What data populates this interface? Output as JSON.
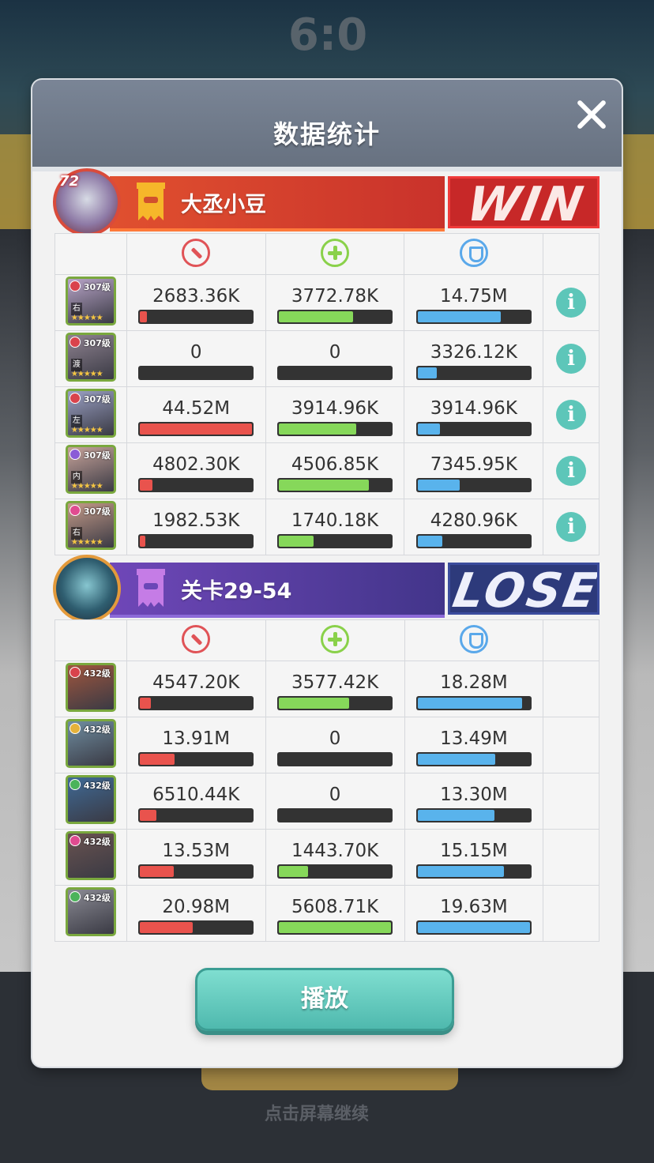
{
  "background": {
    "score": "6:0",
    "bottom_hint": "点击屏幕继续"
  },
  "panel": {
    "title": "数据统计",
    "close_icon": "close-icon"
  },
  "colors": {
    "damage": "#e9534d",
    "heal": "#86d85a",
    "defense": "#59b3ec",
    "info": "#5dc6b9",
    "play_button": "#5dc6b9"
  },
  "teams": [
    {
      "name": "大丞小豆",
      "level": "72",
      "result": "WIN",
      "has_info": true,
      "heroes": [
        {
          "level": "307级",
          "position": "右",
          "damage": "2683.36K",
          "damage_pct": 0.06,
          "heal": "3772.78K",
          "heal_pct": 0.66,
          "defense": "14.75M",
          "defense_pct": 0.74
        },
        {
          "level": "307级",
          "position": "渡",
          "damage": "0",
          "damage_pct": 0,
          "heal": "0",
          "heal_pct": 0,
          "defense": "3326.12K",
          "defense_pct": 0.17
        },
        {
          "level": "307级",
          "position": "左",
          "damage": "44.52M",
          "damage_pct": 1.0,
          "heal": "3914.96K",
          "heal_pct": 0.69,
          "defense": "3914.96K",
          "defense_pct": 0.2
        },
        {
          "level": "307级",
          "position": "内",
          "damage": "4802.30K",
          "damage_pct": 0.11,
          "heal": "4506.85K",
          "heal_pct": 0.8,
          "defense": "7345.95K",
          "defense_pct": 0.37
        },
        {
          "level": "307级",
          "position": "右",
          "damage": "1982.53K",
          "damage_pct": 0.05,
          "heal": "1740.18K",
          "heal_pct": 0.31,
          "defense": "4280.96K",
          "defense_pct": 0.22
        }
      ]
    },
    {
      "name": "关卡29-54",
      "result": "LOSE",
      "has_info": false,
      "heroes": [
        {
          "level": "432级",
          "damage": "4547.20K",
          "damage_pct": 0.1,
          "heal": "3577.42K",
          "heal_pct": 0.63,
          "defense": "18.28M",
          "defense_pct": 0.93
        },
        {
          "level": "432级",
          "damage": "13.91M",
          "damage_pct": 0.31,
          "heal": "0",
          "heal_pct": 0,
          "defense": "13.49M",
          "defense_pct": 0.69
        },
        {
          "level": "432级",
          "damage": "6510.44K",
          "damage_pct": 0.15,
          "heal": "0",
          "heal_pct": 0,
          "defense": "13.30M",
          "defense_pct": 0.68
        },
        {
          "level": "432级",
          "damage": "13.53M",
          "damage_pct": 0.3,
          "heal": "1443.70K",
          "heal_pct": 0.26,
          "defense": "15.15M",
          "defense_pct": 0.77
        },
        {
          "level": "432级",
          "damage": "20.98M",
          "damage_pct": 0.47,
          "heal": "5608.71K",
          "heal_pct": 1.0,
          "defense": "19.63M",
          "defense_pct": 1.0
        }
      ]
    }
  ],
  "play_button": "播放"
}
